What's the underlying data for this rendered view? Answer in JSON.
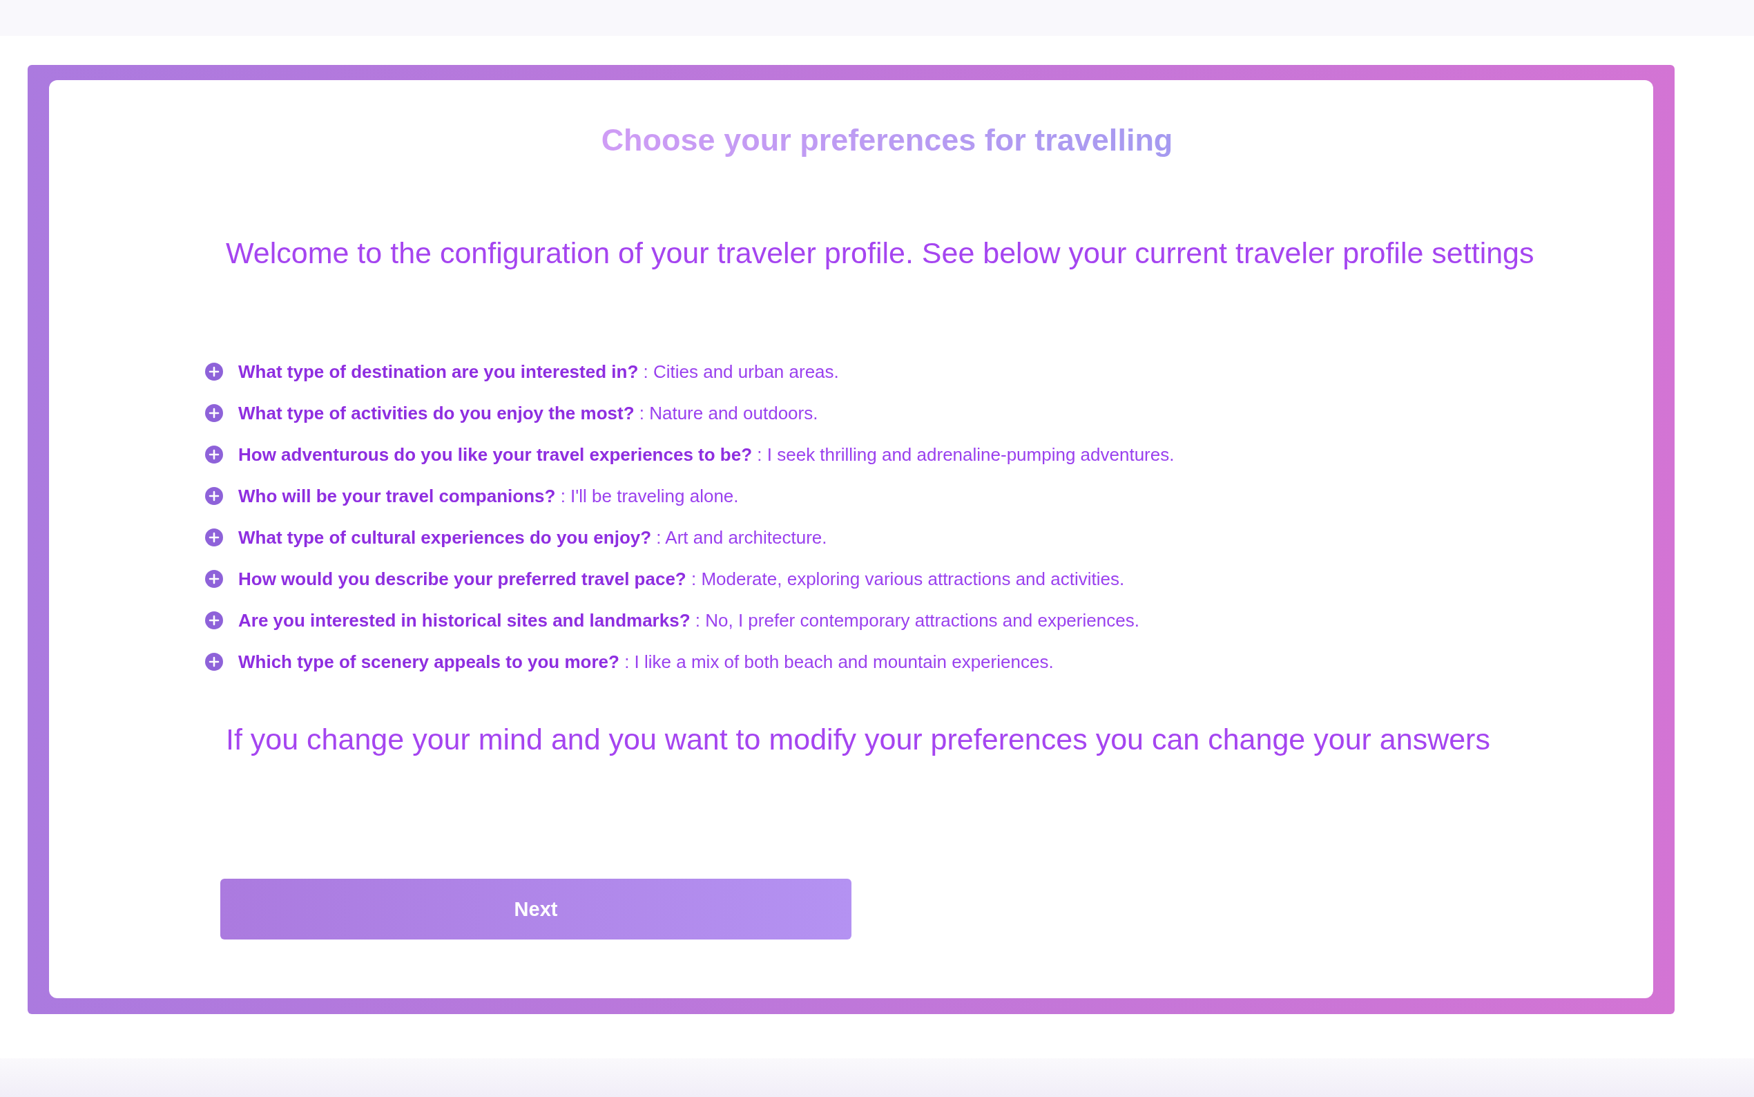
{
  "title": "Choose your preferences for travelling",
  "intro": "Welcome to the configuration of your traveler profile. See below your current traveler profile settings",
  "preferences": [
    {
      "text": "**What type of destination are you interested in?** : Cities and urban areas."
    },
    {
      "text": "**What type of activities do you enjoy the most?** : Nature and outdoors."
    },
    {
      "text": "**How adventurous do you like your travel experiences to be?** : I seek thrilling and adrenaline-pumping adventures."
    },
    {
      "text": "**Who will be your travel companions?** : I'll be traveling alone."
    },
    {
      "text": "**What type of cultural experiences do you enjoy?** : Art and architecture."
    },
    {
      "text": "**How would you describe your preferred travel pace?** : Moderate, exploring various attractions and activities."
    },
    {
      "text": "**Are you interested in historical sites and landmarks?** : No, I prefer contemporary attractions and experiences."
    },
    {
      "text": "**Which type of scenery appeals to you more?** : I like a mix of both beach and mountain experiences."
    }
  ],
  "note": "If you change your mind and you want to modify your preferences you can change your answers",
  "button": "Next"
}
